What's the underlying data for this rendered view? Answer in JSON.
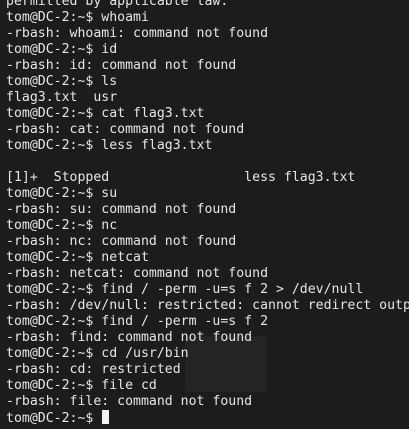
{
  "terminal": {
    "lines": [
      "permitted by applicable law.",
      "tom@DC-2:~$ whoami",
      "-rbash: whoami: command not found",
      "tom@DC-2:~$ id",
      "-rbash: id: command not found",
      "tom@DC-2:~$ ls",
      "flag3.txt  usr",
      "tom@DC-2:~$ cat flag3.txt",
      "-rbash: cat: command not found",
      "tom@DC-2:~$ less flag3.txt",
      "",
      "[1]+  Stopped                 less flag3.txt",
      "tom@DC-2:~$ su",
      "-rbash: su: command not found",
      "tom@DC-2:~$ nc",
      "-rbash: nc: command not found",
      "tom@DC-2:~$ netcat",
      "-rbash: netcat: command not found",
      "tom@DC-2:~$ find / -perm -u=s f 2 > /dev/null",
      "-rbash: /dev/null: restricted: cannot redirect output",
      "tom@DC-2:~$ find / -perm -u=s f 2",
      "-rbash: find: command not found",
      "tom@DC-2:~$ cd /usr/bin",
      "-rbash: cd: restricted",
      "tom@DC-2:~$ file cd",
      "-rbash: file: command not found"
    ],
    "prompt": "tom@DC-2:~$ "
  },
  "colors": {
    "background": "#1c1c1c",
    "foreground": "#e6e6e6",
    "cursor": "#f2f2f2"
  }
}
